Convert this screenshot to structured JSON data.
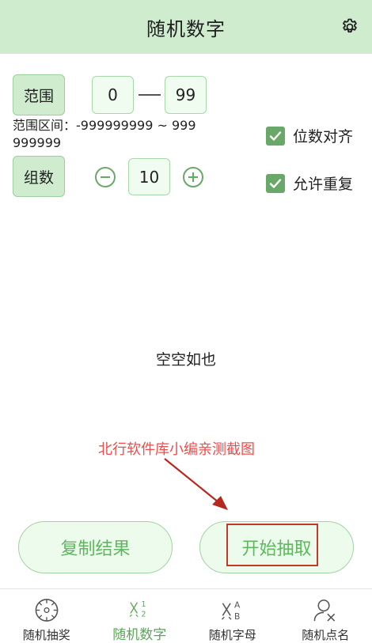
{
  "header": {
    "title": "随机数字",
    "settings_icon": "gear-icon"
  },
  "range": {
    "button_label": "范围",
    "min_value": "0",
    "max_value": "99",
    "info_text": "范围区间：-999999999 ~ 999999999"
  },
  "groups": {
    "button_label": "组数",
    "value": "10",
    "decrement_icon": "minus-circle-icon",
    "increment_icon": "plus-circle-icon"
  },
  "options": {
    "align_digits": {
      "label": "位数对齐",
      "checked": true
    },
    "allow_repeat": {
      "label": "允许重复",
      "checked": true
    }
  },
  "result": {
    "empty_text": "空空如也"
  },
  "watermark": "北行软件库小编亲测截图",
  "actions": {
    "copy_label": "复制结果",
    "start_label": "开始抽取"
  },
  "tabs": [
    {
      "label": "随机抽奖",
      "icon": "wheel-icon",
      "active": false
    },
    {
      "label": "随机数字",
      "icon": "numbers-icon",
      "active": true
    },
    {
      "label": "随机字母",
      "icon": "letters-icon",
      "active": false
    },
    {
      "label": "随机点名",
      "icon": "person-pick-icon",
      "active": false
    }
  ],
  "colors": {
    "accent": "#5aa65a",
    "header_bg": "#cfeccf",
    "annotation_red": "#c0392b"
  }
}
